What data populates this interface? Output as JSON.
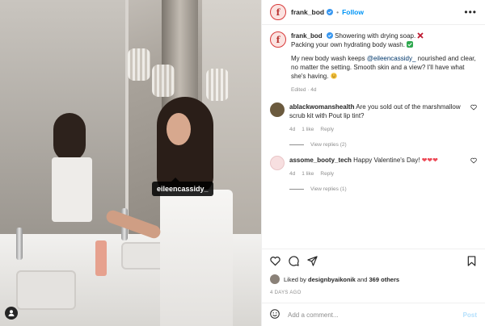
{
  "header": {
    "avatar_letter": "f",
    "username": "frank_bod",
    "dot": "•",
    "follow_label": "Follow",
    "more_label": "•••"
  },
  "photo": {
    "tag_label": "eileencassidy_"
  },
  "caption": {
    "username": "frank_bod",
    "line1": "Showering with drying soap.",
    "line1_icon": "red-x",
    "line2": "Packing your own hydrating body wash.",
    "line2_icon": "green-check",
    "para2_before": "My new body wash keeps ",
    "para2_mention": "@eileencassidy_",
    "para2_after": " nourished and clear, no matter the setting. Smooth skin and a view? I'll have what she's having.",
    "para2_icon": "grinning-face",
    "meta": "Edited · 4d"
  },
  "comments": [
    {
      "username": "ablackwomanshealth",
      "text": "Are you sold out of the marshmallow scrub kit with Pout lip tint?",
      "age": "4d",
      "likes": "1 like",
      "reply_label": "Reply",
      "view_replies": "View replies (2)"
    },
    {
      "username": "assome_booty_tech",
      "text": "Happy Valentine's Day!",
      "hearts": "❤❤❤",
      "age": "4d",
      "likes": "1 like",
      "reply_label": "Reply",
      "view_replies": "View replies (1)"
    }
  ],
  "likes": {
    "prefix": "Liked by",
    "user": "designbyaikonik",
    "and": "and",
    "count": "369 others"
  },
  "timestamp": "4 DAYS AGO",
  "add_comment": {
    "placeholder": "Add a comment...",
    "post_label": "Post"
  },
  "colors": {
    "link": "#0095f6",
    "verified": "#3897f0",
    "mention": "#00376b",
    "heart": "#ed4956"
  }
}
